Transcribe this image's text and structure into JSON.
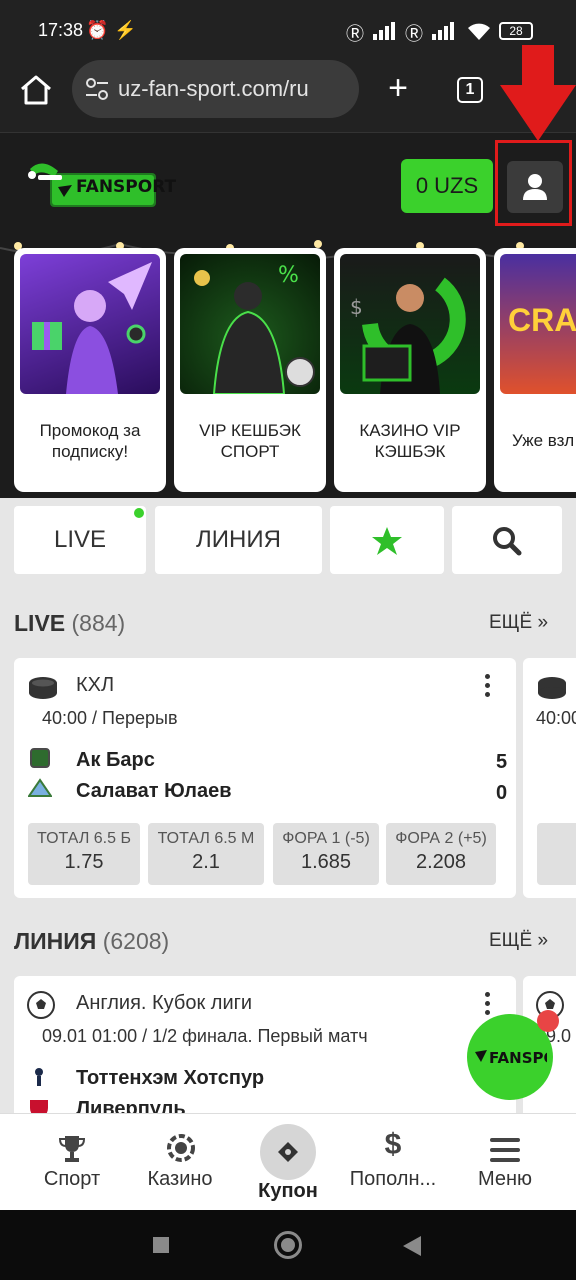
{
  "status_bar": {
    "time": "17:38",
    "battery": "28"
  },
  "browser": {
    "url": "uz-fan-sport.com/ru",
    "tab_count": "1"
  },
  "header": {
    "logo_text": "FANSPORT",
    "balance": "0 UZS"
  },
  "promos": [
    {
      "caption": "Промокод за подписку!"
    },
    {
      "caption": "VIP КЕШБЭК СПОРТ"
    },
    {
      "caption": "КАЗИНО VIP КЭШБЭК"
    },
    {
      "caption": "Уже взл",
      "image_text": "CRA"
    }
  ],
  "tabs": {
    "live": "LIVE",
    "line": "ЛИНИЯ"
  },
  "live_section": {
    "title": "LIVE",
    "count": "(884)",
    "more": "ЕЩЁ »"
  },
  "live_card": {
    "league": "КХЛ",
    "time": "40:00 / Перерыв",
    "team1": "Ак Барс",
    "score1": "5",
    "team2": "Салават Юлаев",
    "score2": "0",
    "odds": [
      {
        "label": "ТОТАЛ 6.5 Б",
        "value": "1.75"
      },
      {
        "label": "ТОТАЛ 6.5 М",
        "value": "2.1"
      },
      {
        "label": "ФОРА 1 (-5)",
        "value": "1.685"
      },
      {
        "label": "ФОРА 2 (+5)",
        "value": "2.208"
      }
    ]
  },
  "live_card_peek": {
    "time": "40:00"
  },
  "line_section": {
    "title": "ЛИНИЯ",
    "count": "(6208)",
    "more": "ЕЩЁ »"
  },
  "line_card": {
    "league": "Англия. Кубок лиги",
    "time": "09.01 01:00 / 1/2 финала. Первый матч",
    "team1": "Тоттенхэм Хотспур",
    "team2": "Ливерпуль"
  },
  "line_card_peek": {
    "time": "09.0"
  },
  "bottom_nav": [
    {
      "label": "Спорт"
    },
    {
      "label": "Казино"
    },
    {
      "label": "Купон"
    },
    {
      "label": "Пополн..."
    },
    {
      "label": "Меню"
    }
  ],
  "colors": {
    "accent": "#3bd12c",
    "dark": "#1c1c1c",
    "highlight": "#e01b1b"
  }
}
